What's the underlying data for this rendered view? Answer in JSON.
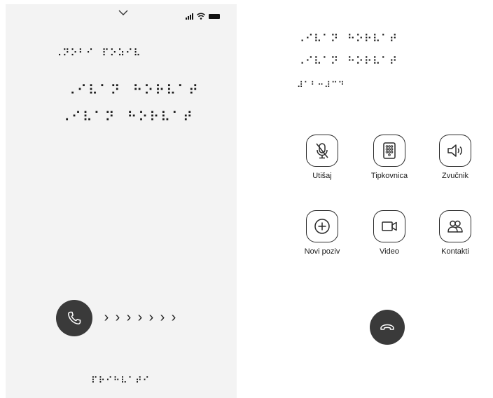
{
  "incoming": {
    "status_braille": "⠠⠝⠕⠃⠊⠀⠏⠕⠵⠊⠧",
    "caller_line1_braille": "⠠⠊⠧⠁⠝⠀⠓⠕⠗⠧⠁⠞",
    "caller_line2_braille": "⠠⠊⠧⠁⠝⠀⠓⠕⠗⠧⠁⠞",
    "arrows": [
      "›",
      "›",
      "›",
      "›",
      "›",
      "›",
      "›"
    ],
    "swipe_braille": "⠏⠗⠊⠓⠧⠁⠞⠊"
  },
  "active": {
    "caller_line1_braille": "⠠⠊⠧⠁⠝⠀⠓⠕⠗⠧⠁⠞",
    "caller_line2_braille": "⠠⠊⠧⠁⠝⠀⠓⠕⠗⠧⠁⠞",
    "timer_braille": "⠼⠁⠃⠒⠼⠉⠙",
    "controls": [
      {
        "label": "Utišaj",
        "icon": "mic-muted-icon"
      },
      {
        "label": "Tipkovnica",
        "icon": "keypad-icon"
      },
      {
        "label": "Zvučnik",
        "icon": "speaker-icon"
      },
      {
        "label": "Novi poziv",
        "icon": "add-call-icon"
      },
      {
        "label": "Video",
        "icon": "video-camera-icon"
      },
      {
        "label": "Kontakti",
        "icon": "contacts-icon"
      }
    ]
  },
  "colors": {
    "left_bg": "#f3f3f3",
    "right_bg": "#ffffff",
    "button_dark": "#3a3a3a",
    "outline": "#2a2a2a"
  }
}
